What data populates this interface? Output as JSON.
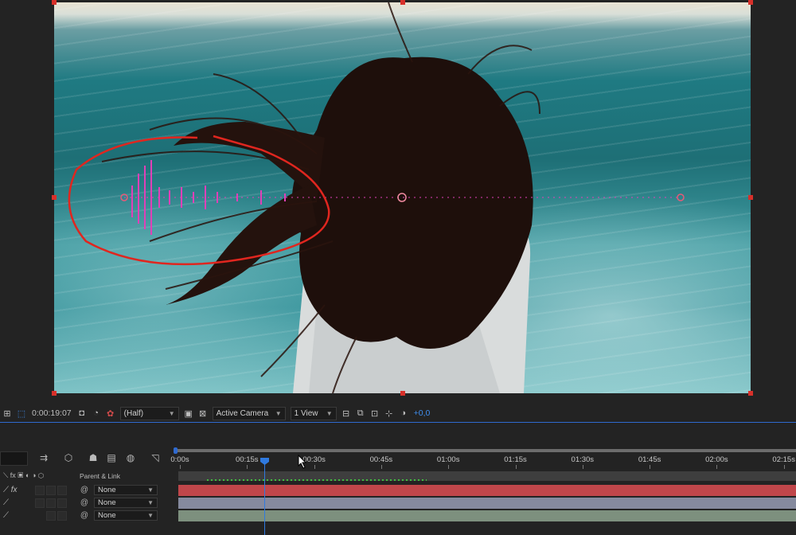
{
  "viewer_toolbar": {
    "timecode": "0:00:19:07",
    "resolution": "(Half)",
    "camera": "Active Camera",
    "views": "1 View",
    "exposure": "+0,0"
  },
  "timeline": {
    "ruler_labels": [
      "0:00s",
      "00:15s",
      "00:30s",
      "00:45s",
      "01:00s",
      "01:15s",
      "01:30s",
      "01:45s",
      "02:00s",
      "02:15s"
    ],
    "parent_link_header": "Parent & Link",
    "layers": [
      {
        "parent": "None",
        "bar_color": "#c0464a"
      },
      {
        "parent": "None",
        "bar_color": "#858a9e"
      },
      {
        "parent": "None",
        "bar_color": "#7d907e"
      }
    ]
  },
  "colors": {
    "accent": "#2f6ad0",
    "selection_handle": "#d8302a",
    "annotation_stroke": "#e0261f",
    "audio_waveform": "#e040b8"
  }
}
